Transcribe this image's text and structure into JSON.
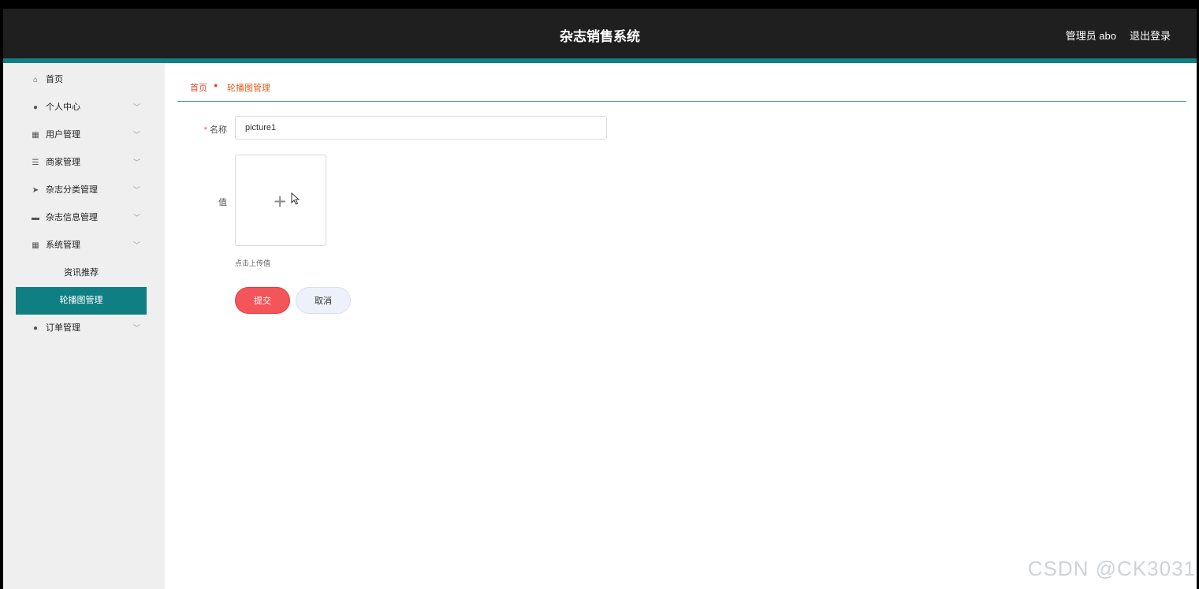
{
  "header": {
    "title": "杂志销售系统",
    "user": "管理员 abo",
    "logout": "退出登录"
  },
  "sidebar": {
    "items": [
      {
        "label": "首页",
        "icon": "home-icon"
      },
      {
        "label": "个人中心",
        "icon": "user-icon"
      },
      {
        "label": "用户管理",
        "icon": "grid-icon"
      },
      {
        "label": "商家管理",
        "icon": "list-icon"
      },
      {
        "label": "杂志分类管理",
        "icon": "send-icon"
      },
      {
        "label": "杂志信息管理",
        "icon": "ticket-icon"
      },
      {
        "label": "系统管理",
        "icon": "grid-icon"
      }
    ],
    "sub_items": [
      {
        "label": "资讯推荐"
      },
      {
        "label": "轮播图管理"
      }
    ],
    "last_item": {
      "label": "订单管理",
      "icon": "user-icon"
    }
  },
  "breadcrumb": {
    "home": "首页",
    "current": "轮播图管理"
  },
  "form": {
    "name_label": "名称",
    "name_value": "picture1",
    "value_label": "值",
    "upload_hint": "点击上传值",
    "submit": "提交",
    "cancel": "取消"
  },
  "watermark": "CSDN @CK3031"
}
